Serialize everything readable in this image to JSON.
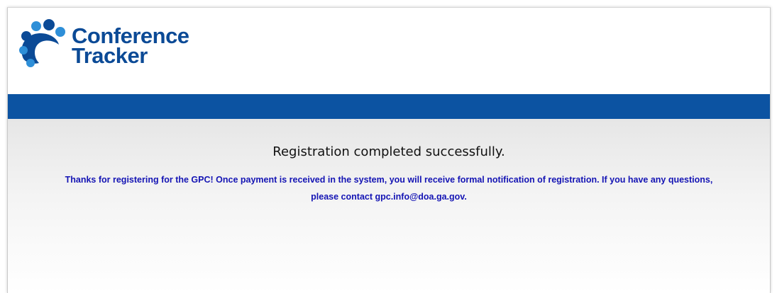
{
  "app": {
    "logo_line1": "Conference",
    "logo_line2": "Tracker",
    "logo_icon": "paw-logo-icon"
  },
  "colors": {
    "brand_blue": "#0b4a96",
    "bar_blue": "#0c53a2",
    "message_blue": "#1414b4",
    "logo_light_blue": "#2e8fd8"
  },
  "main": {
    "status_heading": "Registration completed successfully.",
    "message_line1": "Thanks for registering for the GPC!  Once payment is received in the system, you will receive formal notification of registration.  If you have any questions,",
    "message_line2": "please contact gpc.info@doa.ga.gov."
  }
}
